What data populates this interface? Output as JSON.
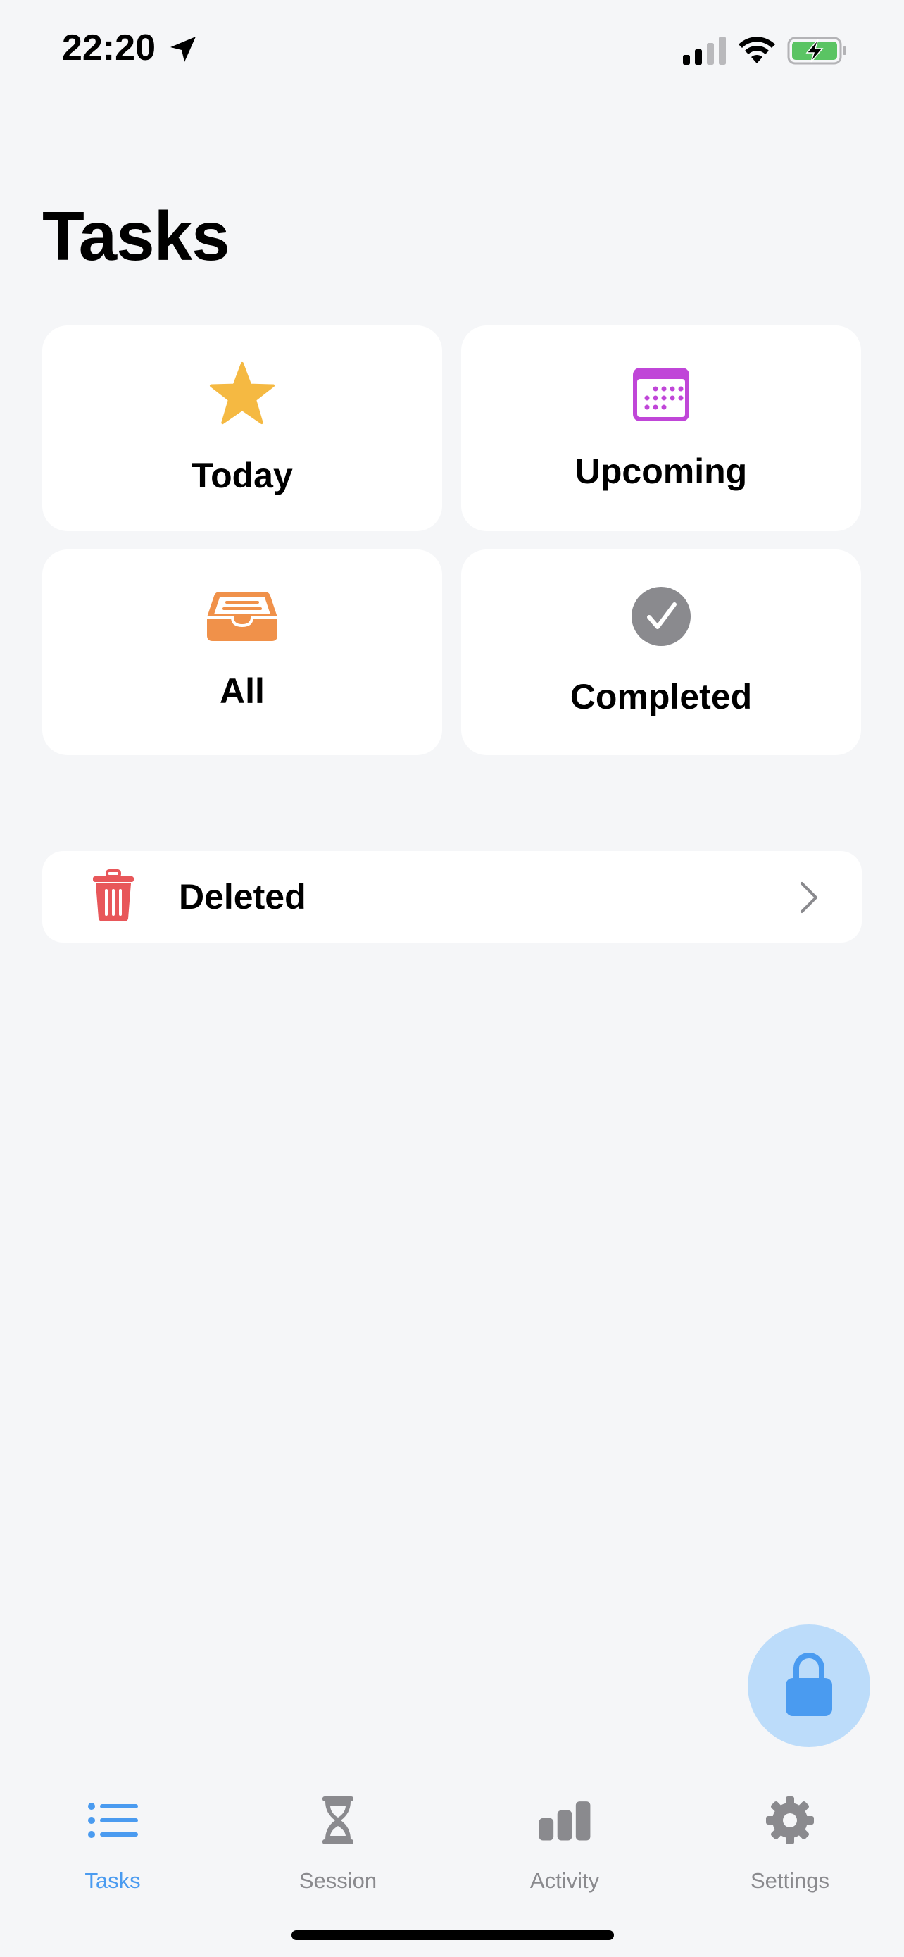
{
  "status_bar": {
    "time": "22:20"
  },
  "page": {
    "title": "Tasks"
  },
  "cards": {
    "today": {
      "label": "Today",
      "icon": "star-icon",
      "color": "#f5b942"
    },
    "upcoming": {
      "label": "Upcoming",
      "icon": "calendar-icon",
      "color": "#c046d8"
    },
    "all": {
      "label": "All",
      "icon": "tray-icon",
      "color": "#f0914a"
    },
    "completed": {
      "label": "Completed",
      "icon": "checkmark-circle-icon",
      "color": "#8a8a8e"
    }
  },
  "deleted": {
    "label": "Deleted",
    "icon": "trash-icon",
    "color": "#e8575a"
  },
  "fab": {
    "icon": "lock-icon",
    "color": "#4a9bf0"
  },
  "tab_bar": {
    "tasks": "Tasks",
    "session": "Session",
    "activity": "Activity",
    "settings": "Settings",
    "active_color": "#4a9bf0",
    "inactive_color": "#8a8a8e"
  }
}
